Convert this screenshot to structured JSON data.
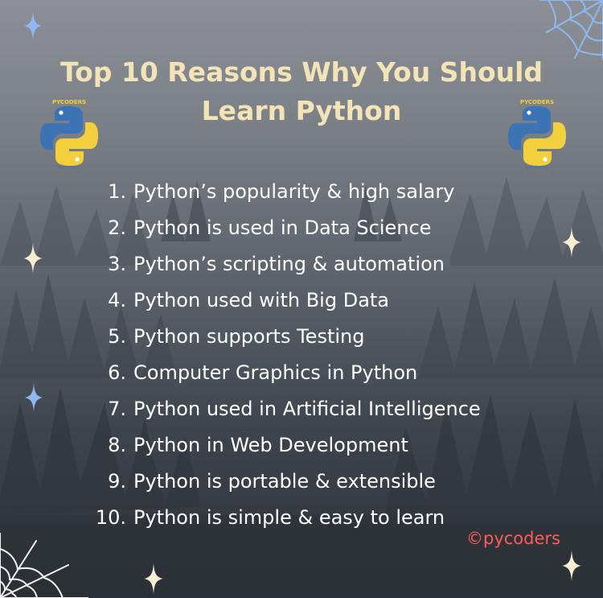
{
  "title": {
    "line1": "Top 10 Reasons Why You Should",
    "line2": "Learn Python"
  },
  "reasons": [
    {
      "num": "1.",
      "text": "Python’s popularity & high salary"
    },
    {
      "num": "2.",
      "text": "Python is used in Data Science"
    },
    {
      "num": "3.",
      "text": "Python’s scripting & automation"
    },
    {
      "num": "4.",
      "text": "Python used with Big Data"
    },
    {
      "num": "5.",
      "text": "Python supports Testing"
    },
    {
      "num": "6.",
      "text": "Computer Graphics in Python"
    },
    {
      "num": "7.",
      "text": "Python used in Artificial Intelligence"
    },
    {
      "num": "8.",
      "text": "Python in Web Development"
    },
    {
      "num": "9.",
      "text": "Python is portable & extensible"
    },
    {
      "num": "10.",
      "text": "Python is simple & easy to learn"
    }
  ],
  "handle": "©pycoders",
  "logo_text": "PYCODERS",
  "colors": {
    "title": "#f3e4b8",
    "text": "#ffffff",
    "handle": "#ff5a5a",
    "python_blue": "#3c73b4",
    "python_yellow": "#f2cf3c",
    "sparkle_blue": "#8fb8f2",
    "sparkle_cream": "#f6edd2",
    "web_white": "#f2f2f2",
    "web_blue": "#8fb8f2"
  },
  "icons": [
    "python-logo-icon",
    "sparkle-icon",
    "spider-web-icon"
  ]
}
